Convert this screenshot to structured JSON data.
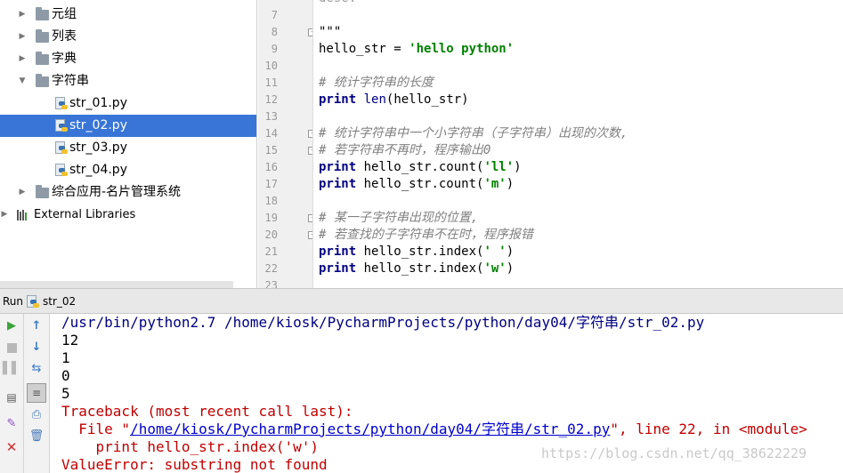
{
  "tree": {
    "items": [
      {
        "label": "元组",
        "kind": "folder",
        "expanded": false
      },
      {
        "label": "列表",
        "kind": "folder",
        "expanded": false
      },
      {
        "label": "字典",
        "kind": "folder",
        "expanded": false
      },
      {
        "label": "字符串",
        "kind": "folder",
        "expanded": true
      },
      {
        "label": "str_01.py",
        "kind": "file"
      },
      {
        "label": "str_02.py",
        "kind": "file",
        "selected": true
      },
      {
        "label": "str_03.py",
        "kind": "file"
      },
      {
        "label": "str_04.py",
        "kind": "file"
      },
      {
        "label": "综合应用-名片管理系统",
        "kind": "folder",
        "expanded": false
      },
      {
        "label": "External Libraries",
        "kind": "library",
        "expanded": false
      }
    ]
  },
  "editor": {
    "lines": [
      {
        "n": "7",
        "text": ""
      },
      {
        "n": "8",
        "text": "\"\"\""
      },
      {
        "n": "9",
        "text": "hello_str = 'hello python'"
      },
      {
        "n": "10",
        "text": ""
      },
      {
        "n": "11",
        "text": "# 统计字符串的长度"
      },
      {
        "n": "12",
        "text": "print len(hello_str)"
      },
      {
        "n": "13",
        "text": ""
      },
      {
        "n": "14",
        "text": "# 统计字符串中一个小字符串（子字符串）出现的次数,"
      },
      {
        "n": "15",
        "text": "# 若字符串不再时，程序输出0"
      },
      {
        "n": "16",
        "text": "print hello_str.count('ll')"
      },
      {
        "n": "17",
        "text": "print hello_str.count('m')"
      },
      {
        "n": "18",
        "text": ""
      },
      {
        "n": "19",
        "text": "# 某一子字符串出现的位置,"
      },
      {
        "n": "20",
        "text": "# 若查找的子字符串不在时，程序报错"
      },
      {
        "n": "21",
        "text": "print hello_str.index(' ')"
      },
      {
        "n": "22",
        "text": "print hello_str.index('w')"
      },
      {
        "n": "23",
        "text": ""
      }
    ],
    "top_partial": "dese:"
  },
  "run": {
    "label": "Run",
    "tab": "str_02"
  },
  "console": {
    "command": "/usr/bin/python2.7 /home/kiosk/PycharmProjects/python/day04/字符串/str_02.py",
    "outputs": [
      "12",
      "1",
      "0",
      "5"
    ],
    "traceback_header": "Traceback (most recent call last):",
    "file_prefix": "  File \"",
    "file_link": "/home/kiosk/PycharmProjects/python/day04/字符串/str_02.py",
    "file_suffix": "\", line 22, in <module>",
    "code_line": "    print hello_str.index('w')",
    "error": "ValueError: substring not found"
  },
  "watermark": "https://blog.csdn.net/qq_38622229"
}
